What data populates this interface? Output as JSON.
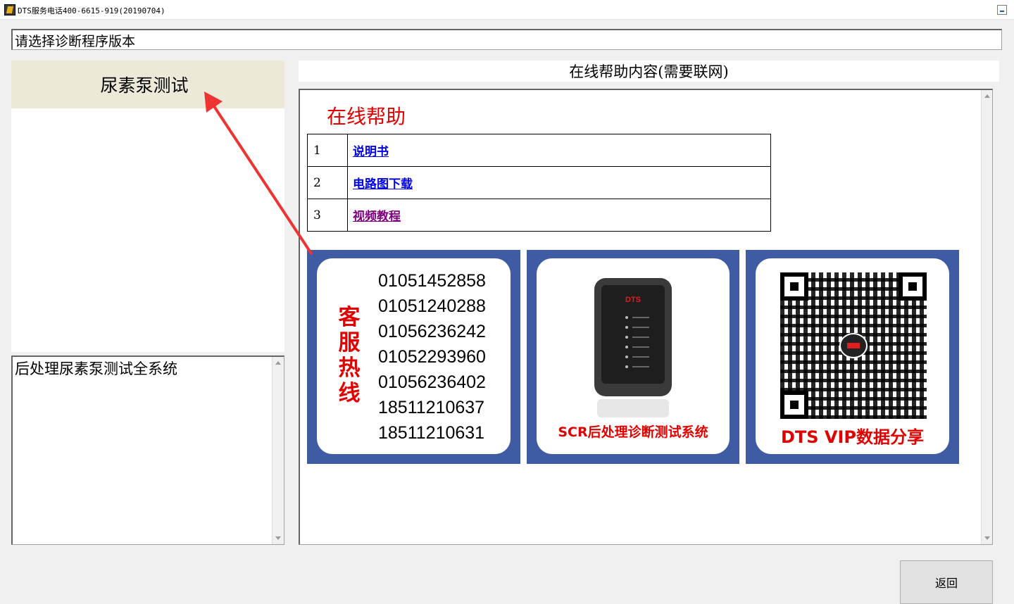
{
  "window": {
    "title": "DTS服务电话400-6615-919(20190704)"
  },
  "version_select": {
    "label": "请选择诊断程序版本"
  },
  "program_list": {
    "items": [
      {
        "label": "尿素泵测试",
        "selected": true
      }
    ]
  },
  "description": {
    "text": "后处理尿素泵测试全系统"
  },
  "help": {
    "header": "在线帮助内容(需要联网)",
    "title": "在线帮助",
    "links": [
      {
        "num": "1",
        "label": "说明书"
      },
      {
        "num": "2",
        "label": "电路图下载"
      },
      {
        "num": "3",
        "label": "视频教程",
        "visited": true
      }
    ],
    "banners": {
      "hotline": {
        "label_chars": [
          "客",
          "服",
          "热",
          "线"
        ],
        "phones": [
          "01051452858",
          "01051240288",
          "01056236242",
          "01052293960",
          "01056236402",
          "18511210637",
          "18511210631"
        ]
      },
      "device": {
        "logo": "DTS",
        "caption": "SCR后处理诊断测试系统"
      },
      "vip": {
        "caption": "DTS VIP数据分享"
      }
    }
  },
  "colors": {
    "accent_red": "#e10000",
    "banner_blue": "#3e5ba4",
    "selected_item_bg": "#ece9d9",
    "link_blue": "#0000ee",
    "link_visited": "#800080"
  },
  "footer": {
    "back_label": "返回"
  }
}
